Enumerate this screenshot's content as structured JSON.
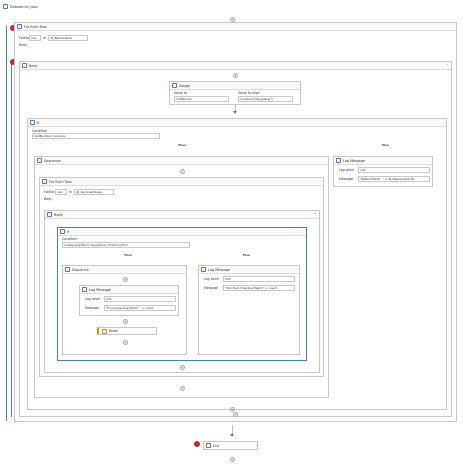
{
  "tab": {
    "title": "Dataadmin_loop"
  },
  "outer_foreach": {
    "header": "For Each Row",
    "foreach_label": "ForEach",
    "item_var": "row",
    "in_label": "in",
    "collection": "dt_Bakelinelist",
    "body_label": "Body"
  },
  "body": {
    "header": "Body"
  },
  "assign": {
    "header": "Assign",
    "to_label": "Value to",
    "value_label": "Value to save",
    "to_value": "matNunito",
    "value_value": "row.Item(\"Keyplaine\")"
  },
  "if1": {
    "header": "If",
    "condition_label": "Condition",
    "condition": "matNumber Success",
    "then_label": "Then",
    "else_label": "Else"
  },
  "else_log": {
    "header": "Log Message",
    "level_label": "Log Level",
    "level": "Info",
    "message_label": "Message",
    "message": "\"Failed Match: \" + dt_Bakelinelist.Ro"
  },
  "sequence": {
    "header": "Sequence"
  },
  "inner_foreach": {
    "header": "For Each Row",
    "foreach_label": "ForEach",
    "item_var": "row",
    "in_label": "in",
    "collection": "dt_KeylinesStage",
    "body_label": "Body"
  },
  "inner_body": {
    "header": "Body"
  },
  "if2": {
    "header": "If",
    "condition_label": "Condition",
    "condition": "rowKeyline.Item(\"Keyplaine\").ToString.Trim",
    "then_label": "Then",
    "else_label": "Else"
  },
  "seq2": {
    "header": "Sequence"
  },
  "log_then": {
    "header": "Log Message",
    "level_label": "Log Level",
    "level": "Info",
    "message_label": "Message",
    "message": "\"Found Keyline Match \" + row.it"
  },
  "break": {
    "header": "Break"
  },
  "log_else": {
    "header": "Log Message",
    "level_label": "Log Level",
    "level": "Info",
    "message_label": "Message",
    "message": "\"Not found Keyline Match\" + row.it"
  },
  "end": {
    "header": "End"
  },
  "colors": {
    "accent": "#4a7dc9",
    "breakpoint": "#c62828",
    "break_accent": "#e08a00"
  }
}
